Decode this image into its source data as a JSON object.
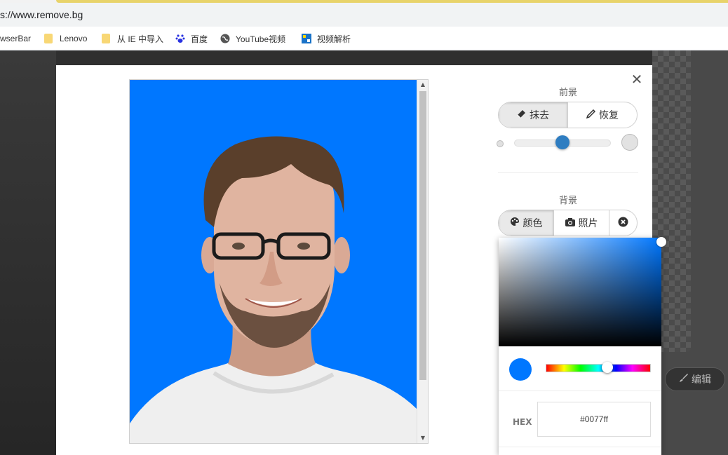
{
  "browser": {
    "url": "s://www.remove.bg",
    "bookmarks": [
      {
        "label": "wserBar",
        "icon": "none"
      },
      {
        "label": "Lenovo",
        "icon": "folder-icon"
      },
      {
        "label": "从 IE 中导入",
        "icon": "folder-icon"
      },
      {
        "label": "百度",
        "icon": "baidu-paw-icon"
      },
      {
        "label": "YouTube视频",
        "icon": "globe-icon"
      },
      {
        "label": "视频解析",
        "icon": "video-parse-icon"
      }
    ]
  },
  "background_page": {
    "edit_button": "编辑"
  },
  "modal": {
    "close_icon": "close-icon",
    "preview_background_color": "#0077ff",
    "foreground": {
      "title": "前景",
      "erase_label": "抹去",
      "restore_label": "恢复",
      "active": "erase"
    },
    "brush_size_level": 0.5,
    "background": {
      "title": "背景",
      "color_label": "颜色",
      "photo_label": "照片",
      "active": "color"
    },
    "color_picker": {
      "hex_label": "HEX",
      "hex_value": "#0077ff",
      "selected_color": "#0077ff"
    }
  }
}
